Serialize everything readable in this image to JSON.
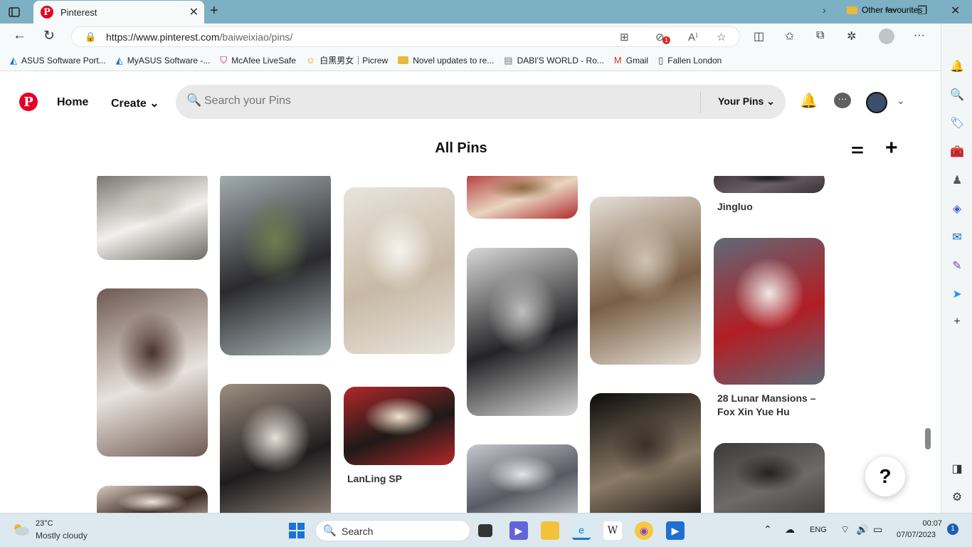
{
  "browser": {
    "tab_title": "Pinterest",
    "tab_close": "✕",
    "new_tab": "+",
    "url_domain": "https://www.pinterest.com",
    "url_path": "/baiweixiao/pins/",
    "window_controls": {
      "minimize": "—",
      "restore": "❐",
      "close": "✕"
    },
    "tracker_badge": "1"
  },
  "favourites": [
    {
      "label": "ASUS Software Port...",
      "icon": "asus-icon"
    },
    {
      "label": "MyASUS Software -...",
      "icon": "asus-icon"
    },
    {
      "label": "McAfee LiveSafe",
      "icon": "mcafee-icon"
    },
    {
      "label": "白黒男女｜Picrew",
      "icon": "picrew-icon"
    },
    {
      "label": "Novel updates to re...",
      "icon": "folder-icon"
    },
    {
      "label": "DABI'S WORLD - Ro...",
      "icon": "page-icon"
    },
    {
      "label": "Gmail",
      "icon": "gmail-icon"
    },
    {
      "label": "Fallen London",
      "icon": "document-icon"
    }
  ],
  "favourites_other": "Other favourites",
  "pinterest": {
    "nav_home": "Home",
    "nav_create": "Create",
    "search_placeholder": "Search your Pins",
    "your_pins": "Your Pins",
    "page_title": "All Pins",
    "help": "?"
  },
  "pins": [
    {
      "col": 0,
      "title": "",
      "colors": [
        "#6d6a63",
        "#f1f0ec",
        "#c9c5bc"
      ]
    },
    {
      "col": 0,
      "title": "",
      "colors": [
        "#6e5a52",
        "#e8e2dc",
        "#4a332c"
      ]
    },
    {
      "col": 0,
      "title": "",
      "colors": [
        "#d9cbc1",
        "#3a2a22",
        "#eee4dc"
      ]
    },
    {
      "col": 1,
      "title": "",
      "colors": [
        "#a8b4b6",
        "#2b2a2e",
        "#6b7d4e"
      ]
    },
    {
      "col": 1,
      "title": "",
      "colors": [
        "#9d8e80",
        "#1e1c1e",
        "#e7e0d8"
      ]
    },
    {
      "col": 2,
      "title": "",
      "colors": [
        "#e9e4dc",
        "#c7b9a5",
        "#f6f3ee"
      ]
    },
    {
      "col": 2,
      "title": "LanLing SP",
      "colors": [
        "#b3272a",
        "#1d1a18",
        "#f0e4cf"
      ]
    },
    {
      "col": 3,
      "title": "",
      "colors": [
        "#b02b2e",
        "#e8d6c0",
        "#8f6a43"
      ]
    },
    {
      "col": 3,
      "title": "",
      "colors": [
        "#d8d8d8",
        "#242426",
        "#bfbfbf"
      ]
    },
    {
      "col": 3,
      "title": "",
      "colors": [
        "#c7c8cf",
        "#5a5a64",
        "#e4e4ea"
      ]
    },
    {
      "col": 4,
      "title": "",
      "colors": [
        "#e6dfd7",
        "#7a5f44",
        "#cfc3b4"
      ]
    },
    {
      "col": 4,
      "title": "",
      "colors": [
        "#0c0a09",
        "#8a7a66",
        "#3b302a"
      ]
    },
    {
      "col": 5,
      "title": "Jingluo",
      "colors": [
        "#3a3236",
        "#6b5f66",
        "#1c181a"
      ]
    },
    {
      "col": 5,
      "title": "28 Lunar Mansions – Fox Xin Yue Hu",
      "colors": [
        "#5e6a78",
        "#b31d24",
        "#f0e8e6"
      ]
    },
    {
      "col": 5,
      "title": "",
      "colors": [
        "#3d3a3a",
        "#6e6a6a",
        "#262222"
      ]
    }
  ],
  "taskbar": {
    "weather_temp": "23°C",
    "weather_desc": "Mostly cloudy",
    "search_label": "Search",
    "language": "ENG",
    "time": "00:07",
    "date": "07/07/2023",
    "notification_count": "1"
  }
}
